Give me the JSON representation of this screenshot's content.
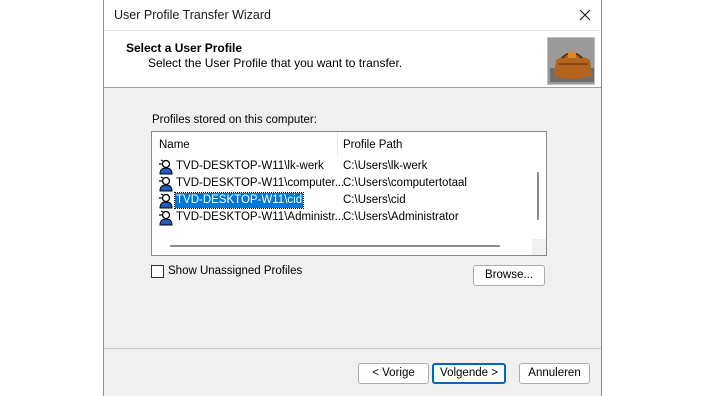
{
  "window": {
    "title": "User Profile Transfer Wizard"
  },
  "header": {
    "title": "Select a User Profile",
    "subtitle": "Select the User Profile that you want to transfer."
  },
  "profiles_label": "Profiles stored on this computer:",
  "table": {
    "columns": [
      "Name",
      "Profile Path"
    ],
    "rows": [
      {
        "name": "TVD-DESKTOP-W11\\lk-werk",
        "path": "C:\\Users\\lk-werk",
        "selected": false
      },
      {
        "name": "TVD-DESKTOP-W11\\computer...",
        "path": "C:\\Users\\computertotaal",
        "selected": false
      },
      {
        "name": "TVD-DESKTOP-W11\\cid",
        "path": "C:\\Users\\cid",
        "selected": true
      },
      {
        "name": "TVD-DESKTOP-W11\\Administr...",
        "path": "C:\\Users\\Administrator",
        "selected": false
      }
    ]
  },
  "show_unassigned": {
    "label": "Show Unassigned Profiles",
    "checked": false
  },
  "buttons": {
    "browse": "Browse...",
    "back": "< Vorige",
    "next": "Volgende >",
    "cancel": "Annuleren"
  },
  "colors": {
    "selection": "#0078d7",
    "default_button_border": "#0067c0"
  }
}
